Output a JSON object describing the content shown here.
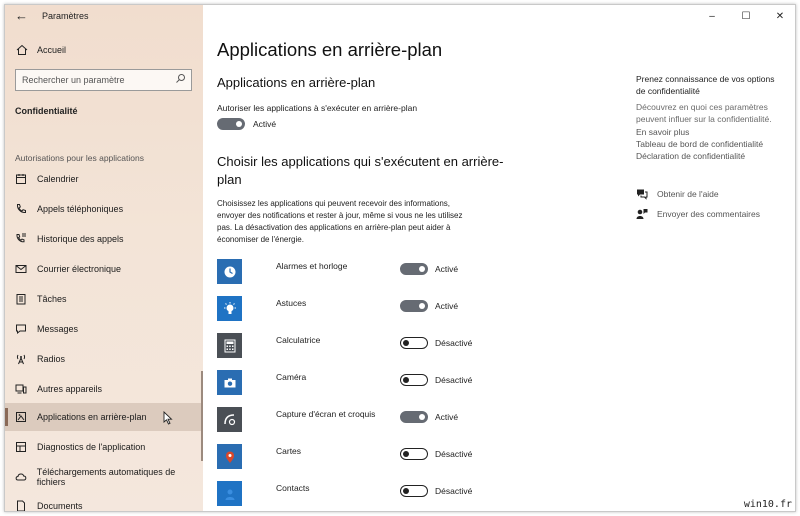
{
  "window": {
    "title": "Paramètres"
  },
  "sidebar": {
    "home": "Accueil",
    "search_placeholder": "Rechercher un paramètre",
    "section_title": "Confidentialité",
    "group_title": "Autorisations pour les applications",
    "items": [
      {
        "label": "Calendrier",
        "icon": "calendar-icon"
      },
      {
        "label": "Appels téléphoniques",
        "icon": "phone-icon"
      },
      {
        "label": "Historique des appels",
        "icon": "history-icon"
      },
      {
        "label": "Courrier électronique",
        "icon": "mail-icon"
      },
      {
        "label": "Tâches",
        "icon": "tasks-icon"
      },
      {
        "label": "Messages",
        "icon": "chat-icon"
      },
      {
        "label": "Radios",
        "icon": "radio-icon"
      },
      {
        "label": "Autres appareils",
        "icon": "devices-icon"
      },
      {
        "label": "Applications en arrière-plan",
        "icon": "background-apps-icon",
        "selected": true
      },
      {
        "label": "Diagnostics de l'application",
        "icon": "diagnostics-icon"
      },
      {
        "label": "Téléchargements automatiques de fichiers",
        "icon": "cloud-download-icon"
      },
      {
        "label": "Documents",
        "icon": "document-icon"
      }
    ]
  },
  "main": {
    "title": "Applications en arrière-plan",
    "section1_title": "Applications en arrière-plan",
    "allow_label": "Autoriser les applications à s'exécuter en arrière-plan",
    "allow_state": "Activé",
    "section2_title_line1": "Choisir les applications qui s'exécutent en arrière-",
    "section2_title_line2": "plan",
    "description": "Choisissez les applications qui peuvent recevoir des informations, envoyer des notifications et rester à jour, même si vous ne les utilisez pas. La désactivation des applications en arrière-plan peut aider à économiser de l'énergie.",
    "apps": [
      {
        "name": "Alarmes et horloge",
        "state": "Activé",
        "on": true,
        "icon": "clock-icon",
        "color": "#2a6db2"
      },
      {
        "name": "Astuces",
        "state": "Activé",
        "on": true,
        "icon": "lightbulb-icon",
        "color": "#1f73c4"
      },
      {
        "name": "Calculatrice",
        "state": "Désactivé",
        "on": false,
        "icon": "calculator-icon",
        "color": "#4a4f55"
      },
      {
        "name": "Caméra",
        "state": "Désactivé",
        "on": false,
        "icon": "camera-icon",
        "color": "#2a6db2"
      },
      {
        "name": "Capture d'écran et croquis",
        "state": "Activé",
        "on": true,
        "icon": "snip-icon",
        "color": "#4a4f55"
      },
      {
        "name": "Cartes",
        "state": "Désactivé",
        "on": false,
        "icon": "map-pin-icon",
        "color": "#2a6db2"
      },
      {
        "name": "Contacts",
        "state": "Désactivé",
        "on": false,
        "icon": "contacts-icon",
        "color": "#1f73c4"
      }
    ]
  },
  "right": {
    "title": "Prenez connaissance de vos options de confidentialité",
    "desc": "Découvrez en quoi ces paramètres peuvent influer sur la confidentialité.",
    "link1": "En savoir plus",
    "link2": "Tableau de bord de confidentialité",
    "link3": "Déclaration de confidentialité",
    "help": "Obtenir de l'aide",
    "feedback": "Envoyer des commentaires"
  },
  "watermark": "win10.fr",
  "colors": {
    "toggle_on": "#666b73",
    "sidebar_bg": "#f2e1d4",
    "accent": "#2a6db2"
  }
}
